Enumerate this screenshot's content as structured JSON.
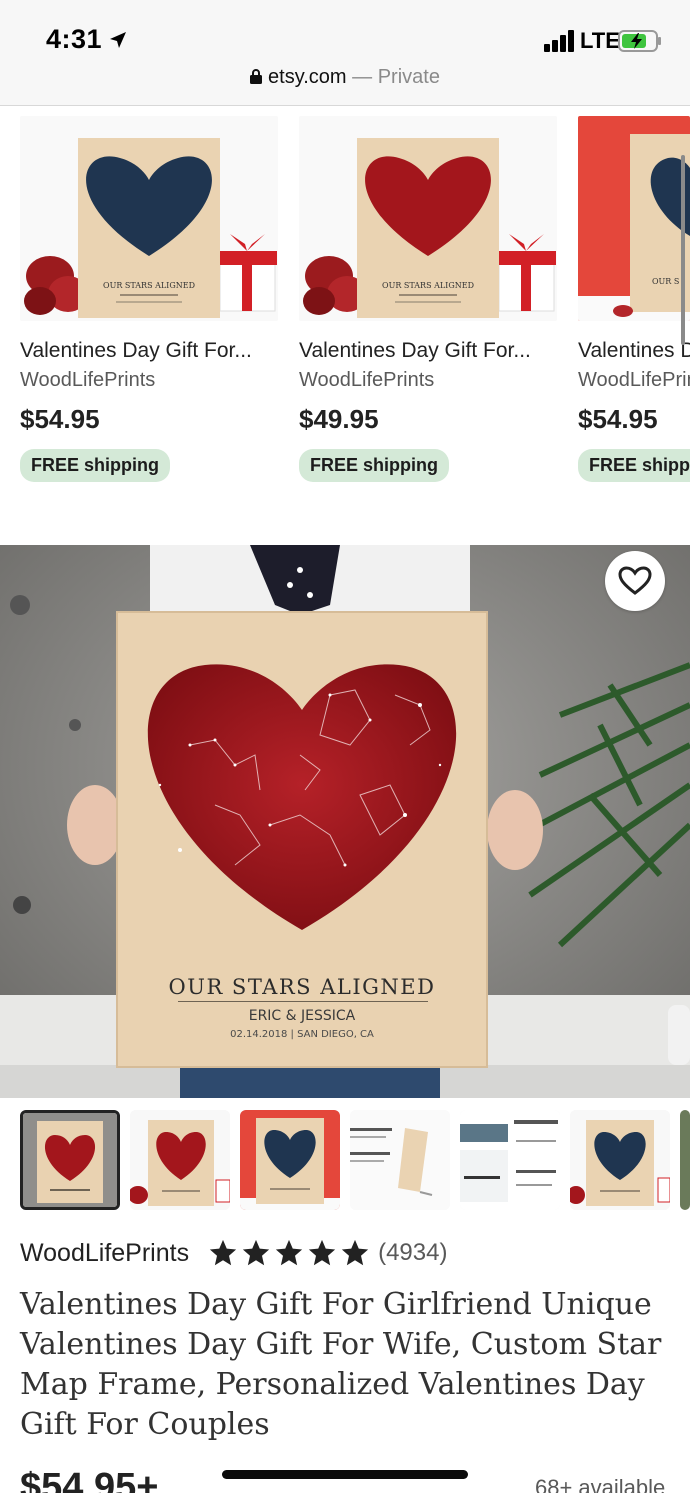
{
  "status_bar": {
    "time": "4:31",
    "network": "LTE",
    "url": "etsy.com",
    "url_suffix": "— Private"
  },
  "recommendations": [
    {
      "title": "Valentines Day Gift For...",
      "shop": "WoodLifePrints",
      "price": "$54.95",
      "shipping": "FREE shipping",
      "heart_color": "navy",
      "print_text": "OUR STARS ALIGNED"
    },
    {
      "title": "Valentines Day Gift For...",
      "shop": "WoodLifePrints",
      "price": "$49.95",
      "shipping": "FREE shipping",
      "heart_color": "red",
      "print_text": "OUR STARS ALIGNED"
    },
    {
      "title": "Valentines Day Gift For...",
      "shop": "WoodLifePrints",
      "price": "$54.95",
      "shipping": "FREE shipping",
      "heart_color": "navy",
      "print_text": "OUR S"
    }
  ],
  "hero": {
    "print_heading": "OUR STARS ALIGNED",
    "print_names": "ERIC & JESSICA",
    "print_date": "02.14.2018 | SAN DIEGO, CA",
    "favorite_icon": "heart-outline-icon"
  },
  "thumbnails": [
    {
      "style": "red-heart",
      "selected": true
    },
    {
      "style": "red-heart",
      "selected": false
    },
    {
      "style": "navy-heart-red-bg",
      "selected": false
    },
    {
      "style": "text-card",
      "selected": false
    },
    {
      "style": "text-card",
      "selected": false
    },
    {
      "style": "navy-heart",
      "selected": false
    }
  ],
  "listing": {
    "shop_name": "WoodLifePrints",
    "rating_stars": 5,
    "review_count": "(4934)",
    "title": "Valentines Day Gift For Girlfriend Unique Valentines Day Gift For Wife, Custom Star Map Frame, Personalized Valentines Day Gift For Couples",
    "price": "$54.95+",
    "availability": "68+ available"
  },
  "colors": {
    "shipping_badge": "#d4e9d7",
    "heart_red": "#a3161c",
    "heart_navy": "#1f3550",
    "wood": "#e9d2b1"
  }
}
